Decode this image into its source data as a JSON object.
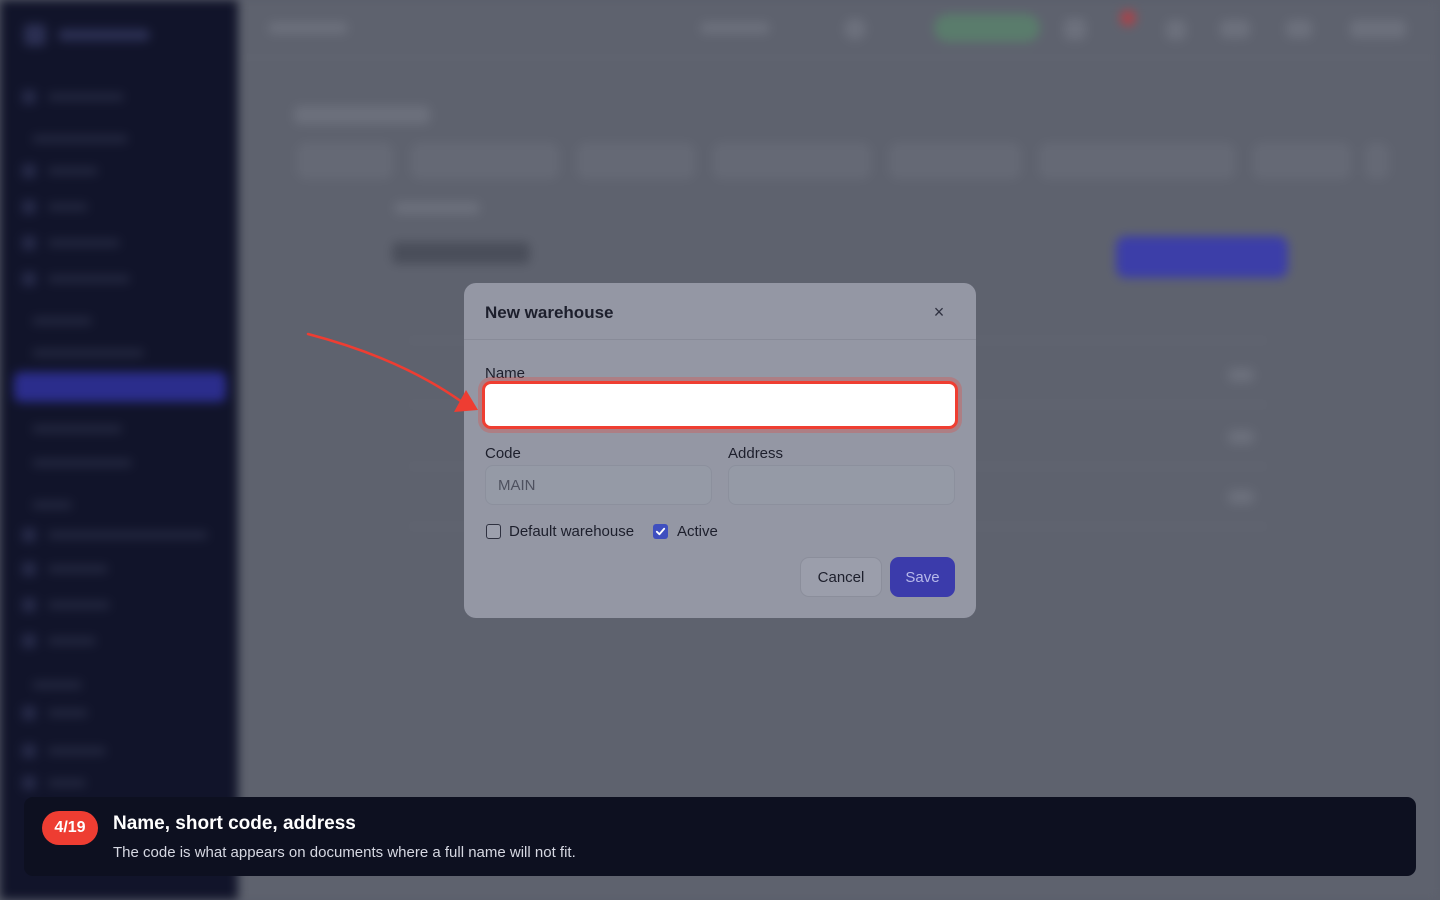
{
  "modal": {
    "title": "New warehouse",
    "close_glyph": "×",
    "name_label": "Name",
    "name_value": "",
    "code_label": "Code",
    "code_placeholder": "MAIN",
    "address_label": "Address",
    "address_placeholder": "",
    "default_label": "Default warehouse",
    "default_checked": false,
    "active_label": "Active",
    "active_checked": true,
    "cancel_label": "Cancel",
    "save_label": "Save"
  },
  "tour": {
    "step": "4/19",
    "title": "Name, short code, address",
    "text": "The code is what appears on documents where a full name will not fit."
  },
  "colors": {
    "highlight": "#ef3e32",
    "primary": "#3b3bab",
    "checkbox_checked": "#3f4fbf",
    "banner_bg": "#0d1020"
  },
  "icons": {
    "close": "close-icon",
    "check": "check-icon",
    "arrow": "pointer-arrow-icon"
  }
}
